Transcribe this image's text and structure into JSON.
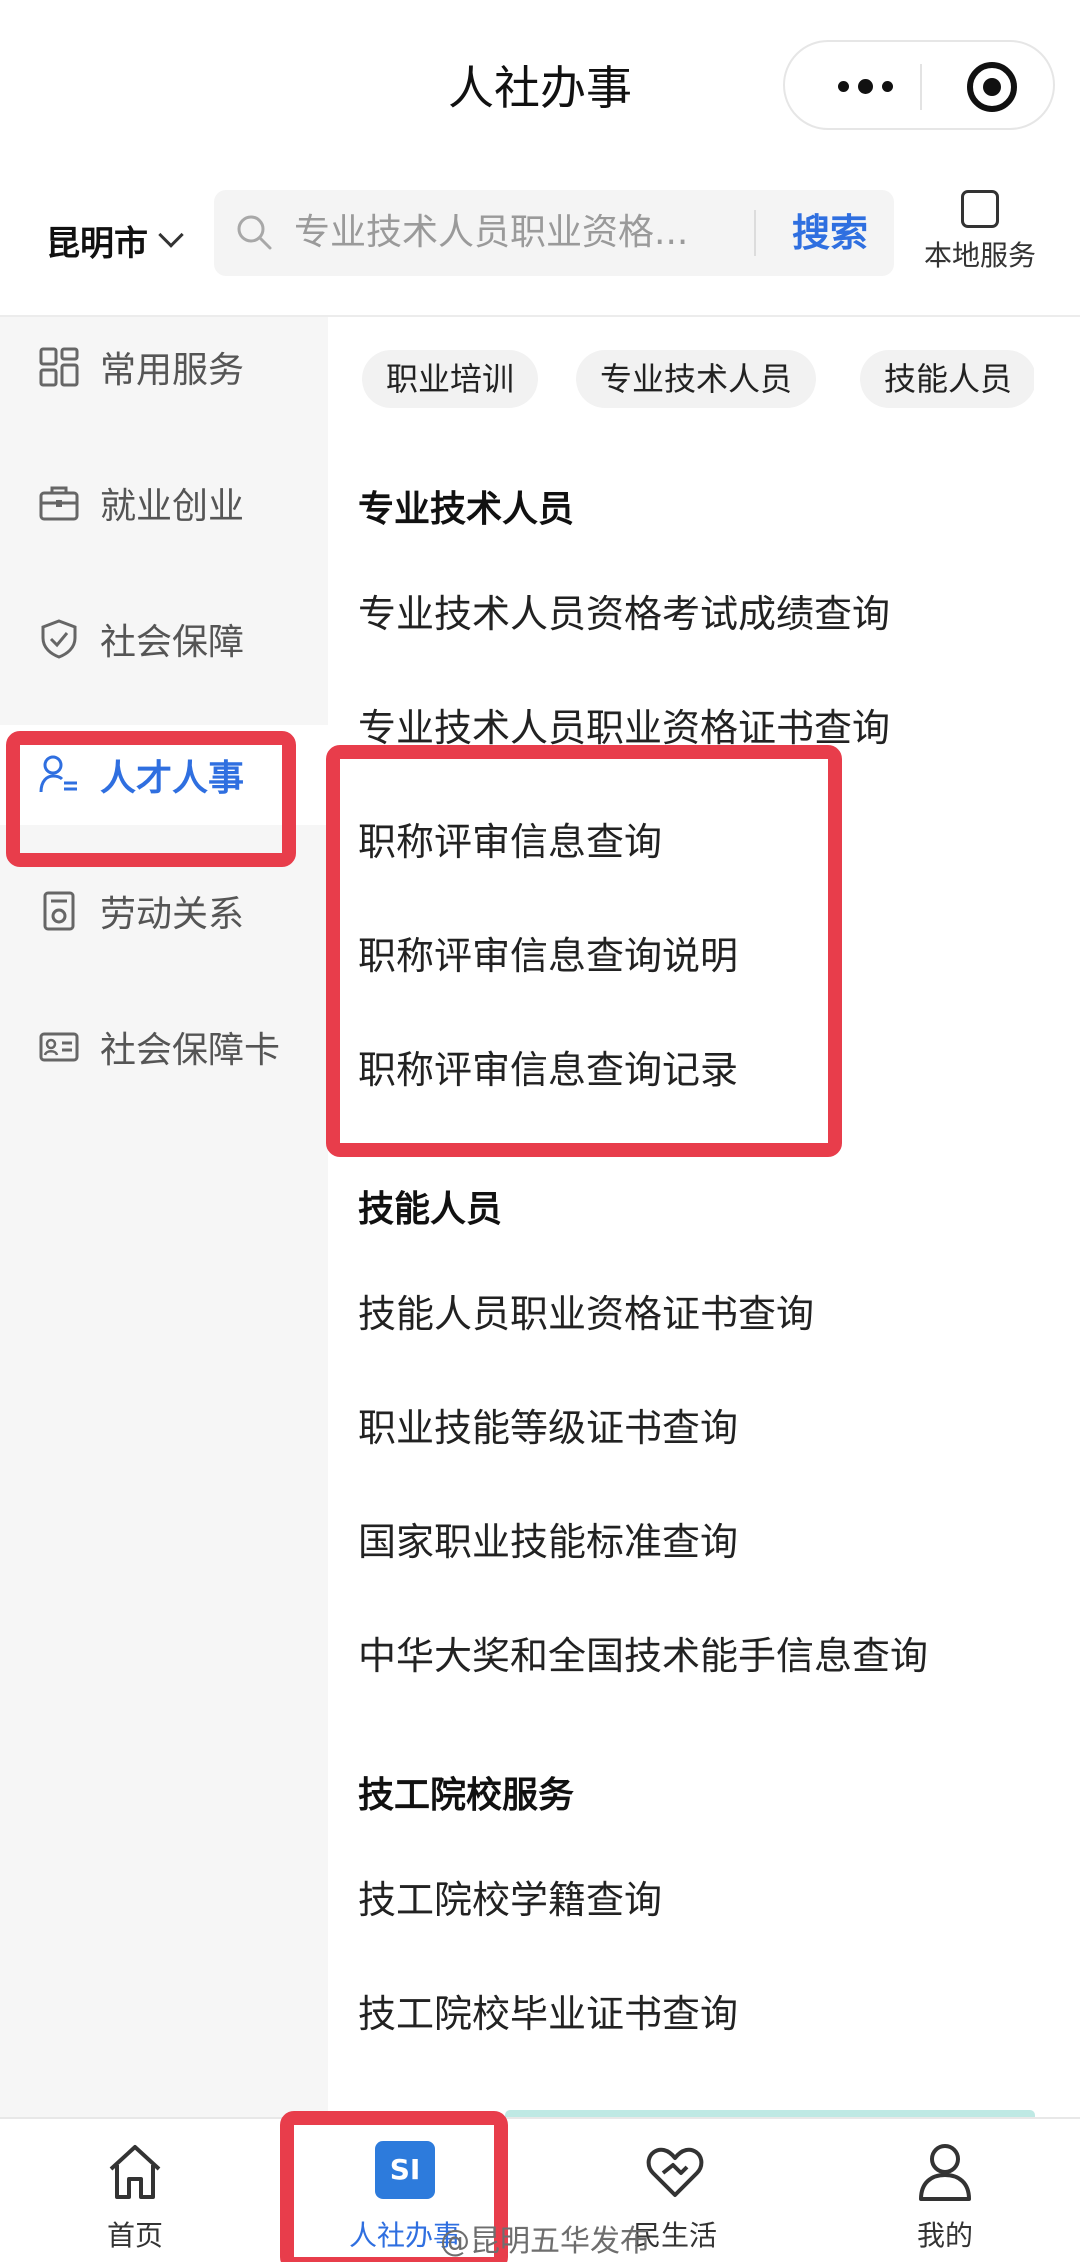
{
  "header": {
    "title": "人社办事"
  },
  "search": {
    "city": "昆明市",
    "placeholder": "专业技术人员职业资格...",
    "button": "搜索",
    "local_service": "本地服务"
  },
  "sidebar": {
    "items": [
      {
        "label": "常用服务",
        "icon": "grid-icon"
      },
      {
        "label": "就业创业",
        "icon": "briefcase-icon"
      },
      {
        "label": "社会保障",
        "icon": "shield-icon"
      },
      {
        "label": "人才人事",
        "icon": "person-list-icon",
        "active": true
      },
      {
        "label": "劳动关系",
        "icon": "document-seal-icon"
      },
      {
        "label": "社会保障卡",
        "icon": "id-card-icon"
      }
    ]
  },
  "chips": [
    "职业培训",
    "专业技术人员",
    "技能人员"
  ],
  "sections": [
    {
      "title": "专业技术人员",
      "items": [
        "专业技术人员资格考试成绩查询",
        "专业技术人员职业资格证书查询",
        "职称评审信息查询",
        "职称评审信息查询说明",
        "职称评审信息查询记录"
      ]
    },
    {
      "title": "技能人员",
      "items": [
        "技能人员职业资格证书查询",
        "职业技能等级证书查询",
        "国家职业技能标准查询",
        "中华大奖和全国技术能手信息查询"
      ]
    },
    {
      "title": "技工院校服务",
      "items": [
        "技工院校学籍查询",
        "技工院校毕业证书查询"
      ]
    }
  ],
  "tabbar": {
    "items": [
      {
        "label": "首页",
        "icon": "home-icon"
      },
      {
        "label": "人社办事",
        "badge": "SI",
        "icon": "si-badge-icon",
        "active": true
      },
      {
        "label": "民生活",
        "icon": "handshake-heart-icon"
      },
      {
        "label": "我的",
        "icon": "user-icon"
      }
    ]
  },
  "watermark": "@昆明五华发布",
  "colors": {
    "accent": "#2f6fe0",
    "annotation": "#e83d4b",
    "badge": "#2d7bdc"
  }
}
